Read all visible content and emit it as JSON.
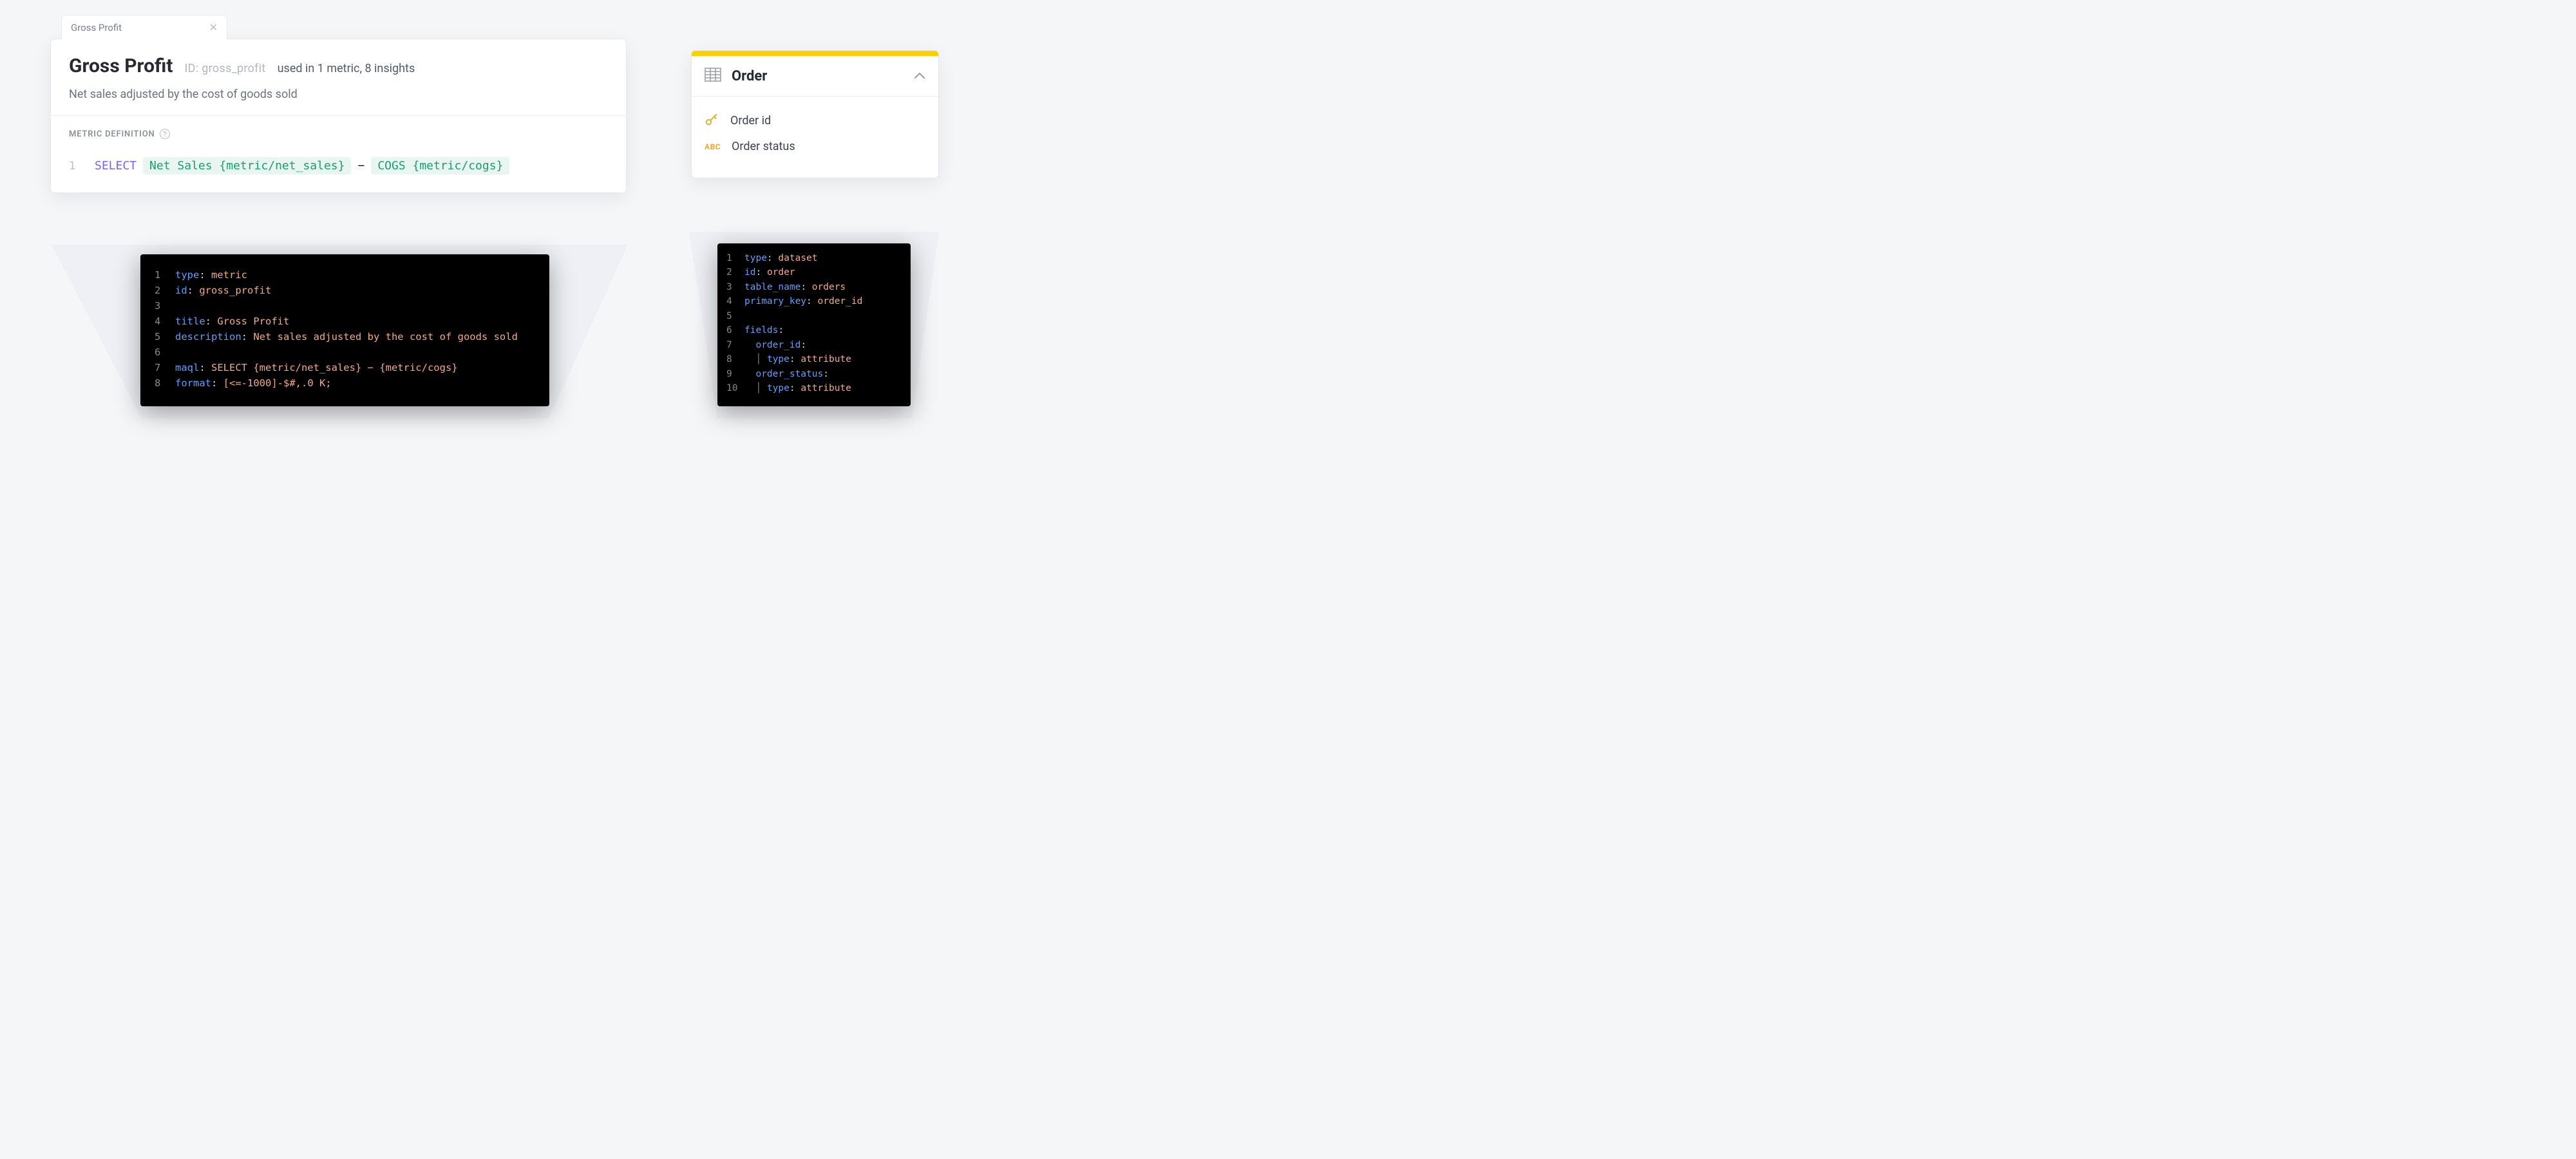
{
  "metric_card": {
    "tab_label": "Gross Profit",
    "title": "Gross Profit",
    "id_prefix": "ID: ",
    "id_value": "gross_profit",
    "usage": "used in  1 metric, 8 insights",
    "description": "Net sales adjusted by the cost of goods sold",
    "section_label": "METRIC DEFINITION",
    "maql": {
      "line_num": "1",
      "select": "SELECT",
      "pill1": "Net Sales {metric/net_sales}",
      "minus": "−",
      "pill2": "COGS {metric/cogs}"
    }
  },
  "metric_code": {
    "lines": [
      {
        "n": "1",
        "k": "type",
        "v": "metric"
      },
      {
        "n": "2",
        "k": "id",
        "v": "gross_profit"
      },
      {
        "n": "3",
        "blank": true
      },
      {
        "n": "4",
        "k": "title",
        "v": "Gross Profit"
      },
      {
        "n": "5",
        "k": "description",
        "v": "Net sales adjusted by the cost of goods sold"
      },
      {
        "n": "6",
        "blank": true
      },
      {
        "n": "7",
        "k": "maql",
        "v": "SELECT {metric/net_sales} − {metric/cogs}"
      },
      {
        "n": "8",
        "k": "format",
        "v": "[<=-1000]-$#,.0 K;"
      }
    ]
  },
  "order_card": {
    "title": "Order",
    "fields": [
      {
        "icon": "key",
        "label": "Order id"
      },
      {
        "icon": "abc",
        "label": "Order status"
      }
    ],
    "abc_text": "ABC"
  },
  "order_code": {
    "lines": [
      {
        "n": "1",
        "k": "type",
        "v": "dataset"
      },
      {
        "n": "2",
        "k": "id",
        "v": "order"
      },
      {
        "n": "3",
        "k": "table_name",
        "v": "orders"
      },
      {
        "n": "4",
        "k": "primary_key",
        "v": "order_id"
      },
      {
        "n": "5",
        "blank": true
      },
      {
        "n": "6",
        "k": "fields",
        "colon_only": true
      },
      {
        "n": "7",
        "k": "order_id",
        "indent": 1,
        "colon_only": true
      },
      {
        "n": "8",
        "k": "type",
        "v": "attribute",
        "indent": 1,
        "bar": true
      },
      {
        "n": "9",
        "k": "order_status",
        "indent": 1,
        "colon_only": true
      },
      {
        "n": "10",
        "k": "type",
        "v": "attribute",
        "indent": 1,
        "bar": true
      }
    ]
  }
}
